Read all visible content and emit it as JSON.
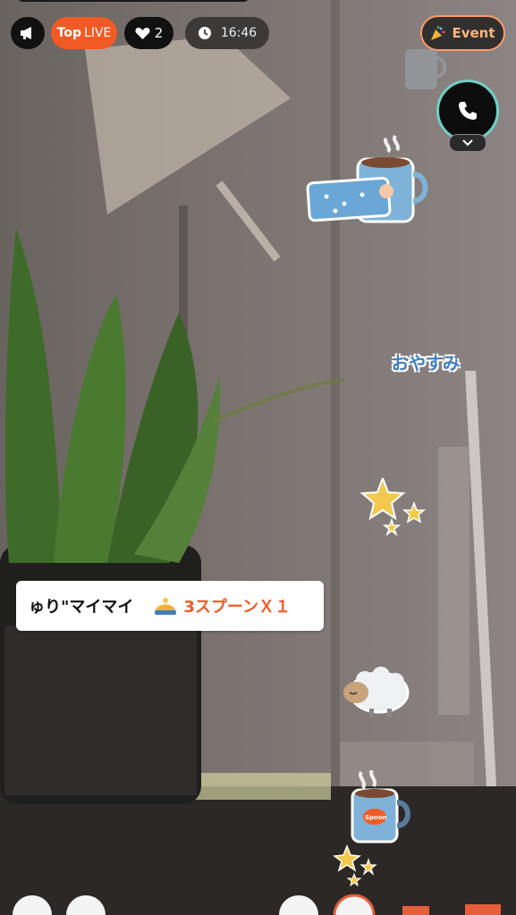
{
  "status_bar": {
    "top_label": "Top",
    "live_label": "LIVE",
    "likes_count": "2",
    "timer": "16:46",
    "event_label": "Event"
  },
  "gift_notice": {
    "user_name": "ゅり\"マイマイ",
    "gift_text": "3スプーンＸ１"
  },
  "stickers": {
    "goodnight_text": "おやすみ",
    "mug_label": "Spoon"
  },
  "colors": {
    "accent": "#f15a24",
    "event_border": "#ff9a6a",
    "call_ring": "#6fd0c6"
  }
}
